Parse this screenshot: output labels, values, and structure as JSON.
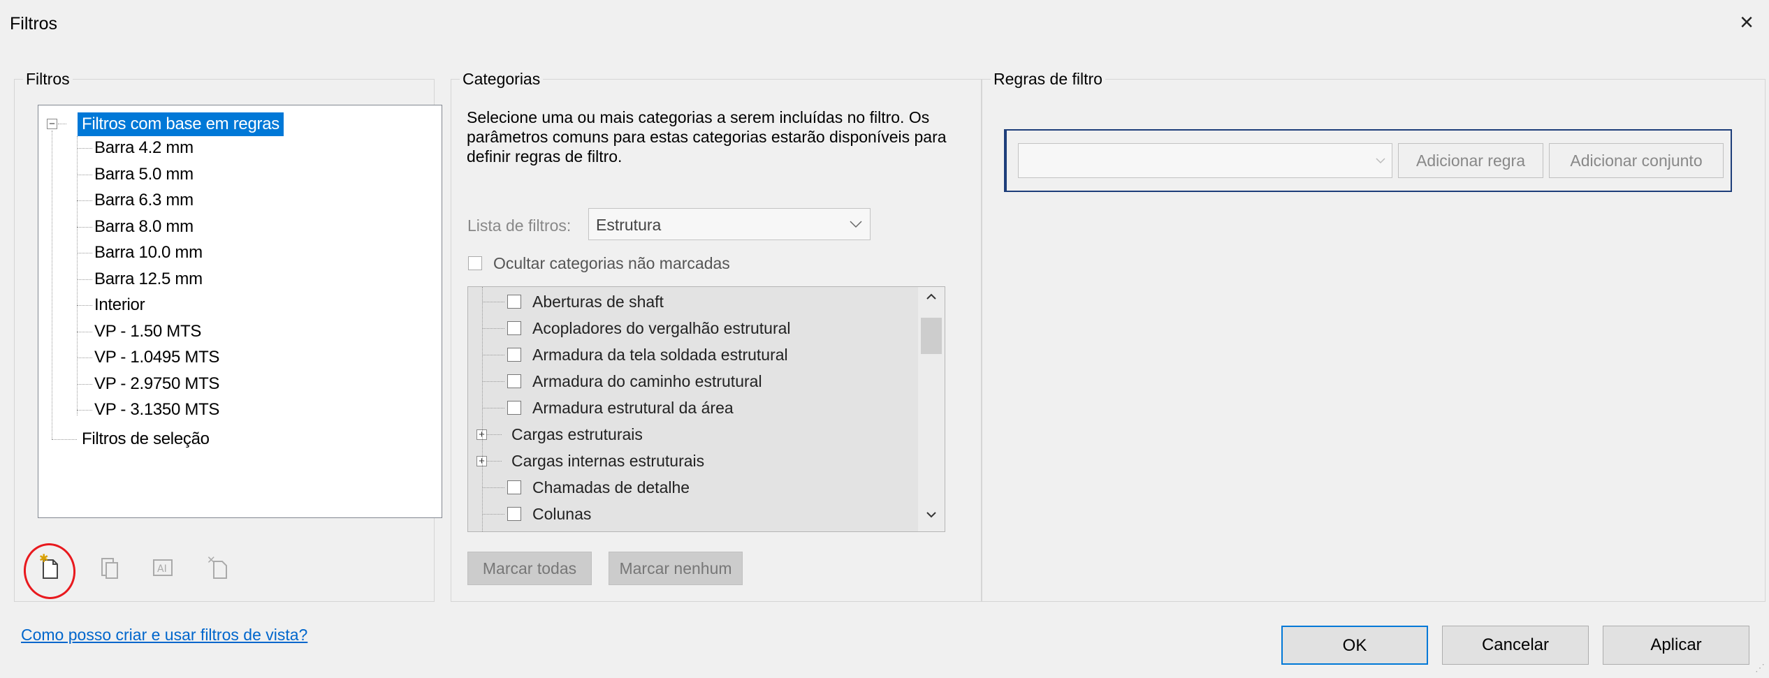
{
  "dialog": {
    "title": "Filtros",
    "close_icon": "×"
  },
  "filters_group": {
    "legend": "Filtros",
    "tree": {
      "root_rule": "Filtros com base em regras",
      "rule_items": [
        "Barra 4.2 mm",
        "Barra 5.0 mm",
        "Barra 6.3 mm",
        "Barra 8.0 mm",
        "Barra 10.0 mm",
        "Barra 12.5 mm",
        "Interior",
        "VP - 1.50 MTS",
        "VP - 1.0495 MTS",
        "VP - 2.9750 MTS",
        "VP - 3.1350 MTS"
      ],
      "root_selection": "Filtros de seleção",
      "collapse_symbol": "−"
    },
    "toolbar_icons": [
      "new-filter-icon",
      "duplicate-filter-icon",
      "rename-filter-icon",
      "delete-filter-icon"
    ]
  },
  "categories_group": {
    "legend": "Categorias",
    "description": "Selecione uma ou mais categorias a serem incluídas no filtro. Os parâmetros comuns para estas categorias estarão disponíveis para definir regras de filtro.",
    "filter_list_label": "Lista de filtros:",
    "filter_list_value": "Estrutura",
    "hide_unchecked_label": "Ocultar categorias não marcadas",
    "items": [
      {
        "label": "Aberturas de shaft",
        "kind": "checkbox"
      },
      {
        "label": "Acopladores do vergalhão estrutural",
        "kind": "checkbox"
      },
      {
        "label": "Armadura da tela soldada estrutural",
        "kind": "checkbox"
      },
      {
        "label": "Armadura do caminho estrutural",
        "kind": "checkbox"
      },
      {
        "label": "Armadura estrutural da área",
        "kind": "checkbox"
      },
      {
        "label": "Cargas estruturais",
        "kind": "expand"
      },
      {
        "label": "Cargas internas estruturais",
        "kind": "expand"
      },
      {
        "label": "Chamadas de detalhe",
        "kind": "checkbox"
      },
      {
        "label": "Colunas",
        "kind": "checkbox"
      }
    ],
    "expand_symbol": "+",
    "scroll_up": "^",
    "scroll_down": "v",
    "check_all": "Marcar todas",
    "check_none": "Marcar nenhum"
  },
  "rules_group": {
    "legend": "Regras de filtro",
    "dropdown_value": "",
    "add_rule": "Adicionar regra",
    "add_set": "Adicionar conjunto"
  },
  "help_link": "Como posso criar e usar filtros de vista?",
  "buttons": {
    "ok": "OK",
    "cancel": "Cancelar",
    "apply": "Aplicar"
  },
  "colors": {
    "selection": "#0078d7",
    "annotation_circle": "#e8191e",
    "link": "#0066cc"
  }
}
